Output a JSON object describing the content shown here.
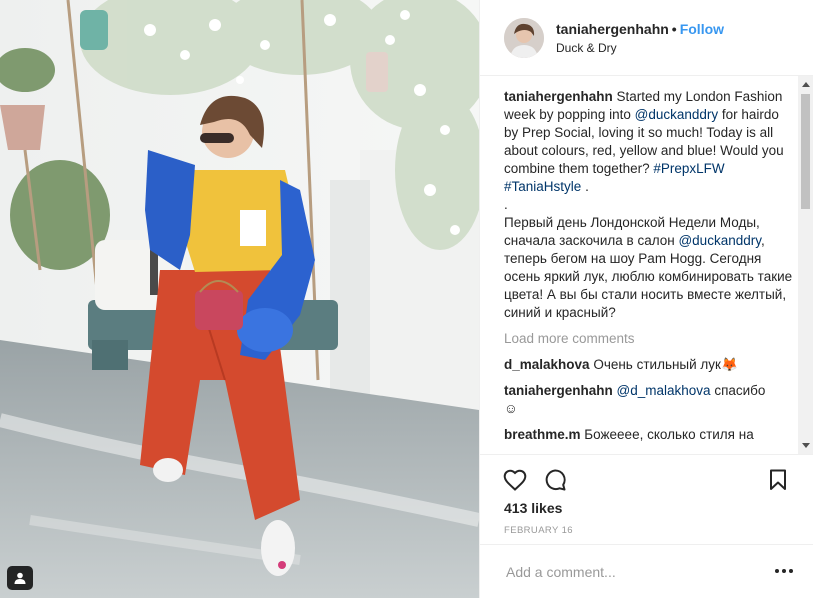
{
  "post": {
    "username": "taniahergenhahn",
    "separator": "•",
    "follow_label": "Follow",
    "location": "Duck & Dry",
    "caption": {
      "username": "taniahergenhahn",
      "en_1": "Started my London Fashion week by popping into",
      "mention_1": "@duckanddry",
      "en_2": "for hairdo by Prep Social, loving it so much! Today is all about colours, red, yellow and blue! Would you combine them together?",
      "hashtag_1": "#PrepxLFW",
      "hashtag_2": "#TaniaHstyle",
      "period": ".",
      "spacer": ".",
      "ru_1": "Первый день Лондонской Недели Моды, сначала заскочила в салон",
      "mention_2": "@duckanddry",
      "ru_2": ", теперь бегом на шоу Pam Hogg. Сегодня осень яркий лук, люблю комбинировать такие цвета! А вы бы стали носить вместе желтый, синий и красный?"
    },
    "load_more_label": "Load more comments",
    "comments": [
      {
        "username": "d_malakhova",
        "text": "Очень стильный лук",
        "emoji": "🦊"
      },
      {
        "username": "taniahergenhahn",
        "mention": "@d_malakhova",
        "text": "спасибо",
        "emoji": "☺"
      },
      {
        "username": "breathme.m",
        "text": "Божееее, сколько стиля на"
      }
    ],
    "likes_label": "413 likes",
    "date_label": "FEBRUARY 16",
    "add_comment_placeholder": "Add a comment...",
    "more_label": "•••"
  },
  "icons": {
    "heart": "heart-icon",
    "comment": "comment-bubble-icon",
    "bookmark": "bookmark-icon",
    "tag": "user-tag-icon"
  },
  "colors": {
    "follow": "#3897f0",
    "link": "#003569",
    "muted": "#999999",
    "text": "#262626"
  }
}
